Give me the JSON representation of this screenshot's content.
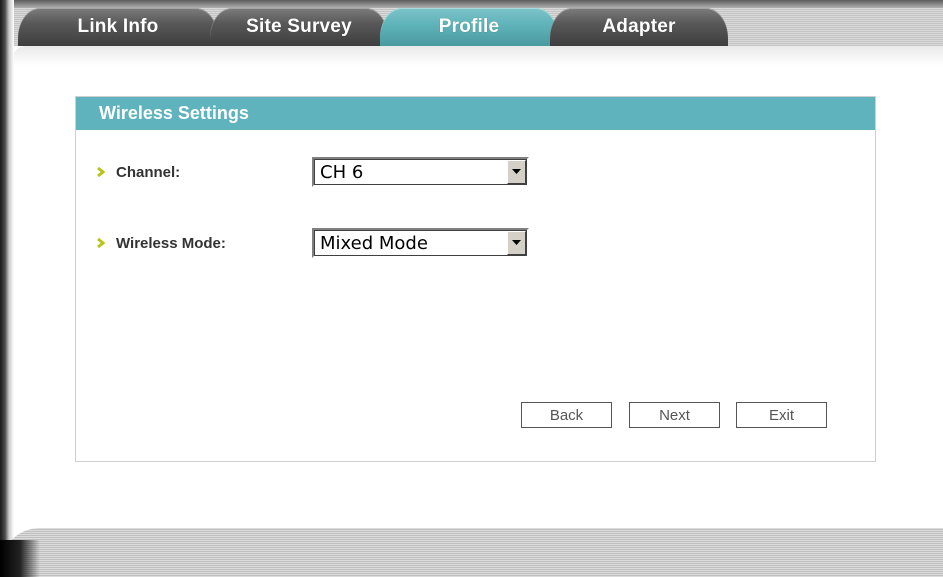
{
  "tabs": [
    {
      "label": "Link Info",
      "active": false
    },
    {
      "label": "Site Survey",
      "active": false
    },
    {
      "label": "Profile",
      "active": true
    },
    {
      "label": "Adapter",
      "active": false
    }
  ],
  "panel": {
    "title": "Wireless Settings",
    "channel": {
      "label": "Channel:",
      "value": "CH 6"
    },
    "wireless_mode": {
      "label": "Wireless Mode:",
      "value": "Mixed Mode"
    }
  },
  "buttons": {
    "back": "Back",
    "next": "Next",
    "exit": "Exit"
  },
  "colors": {
    "accent": "#5fb3bc",
    "tab_inactive": "#595959",
    "bullet": "#b8c41a"
  },
  "icons": {
    "bullet": "chevron-right-icon",
    "dropdown": "dropdown-arrow-icon"
  }
}
